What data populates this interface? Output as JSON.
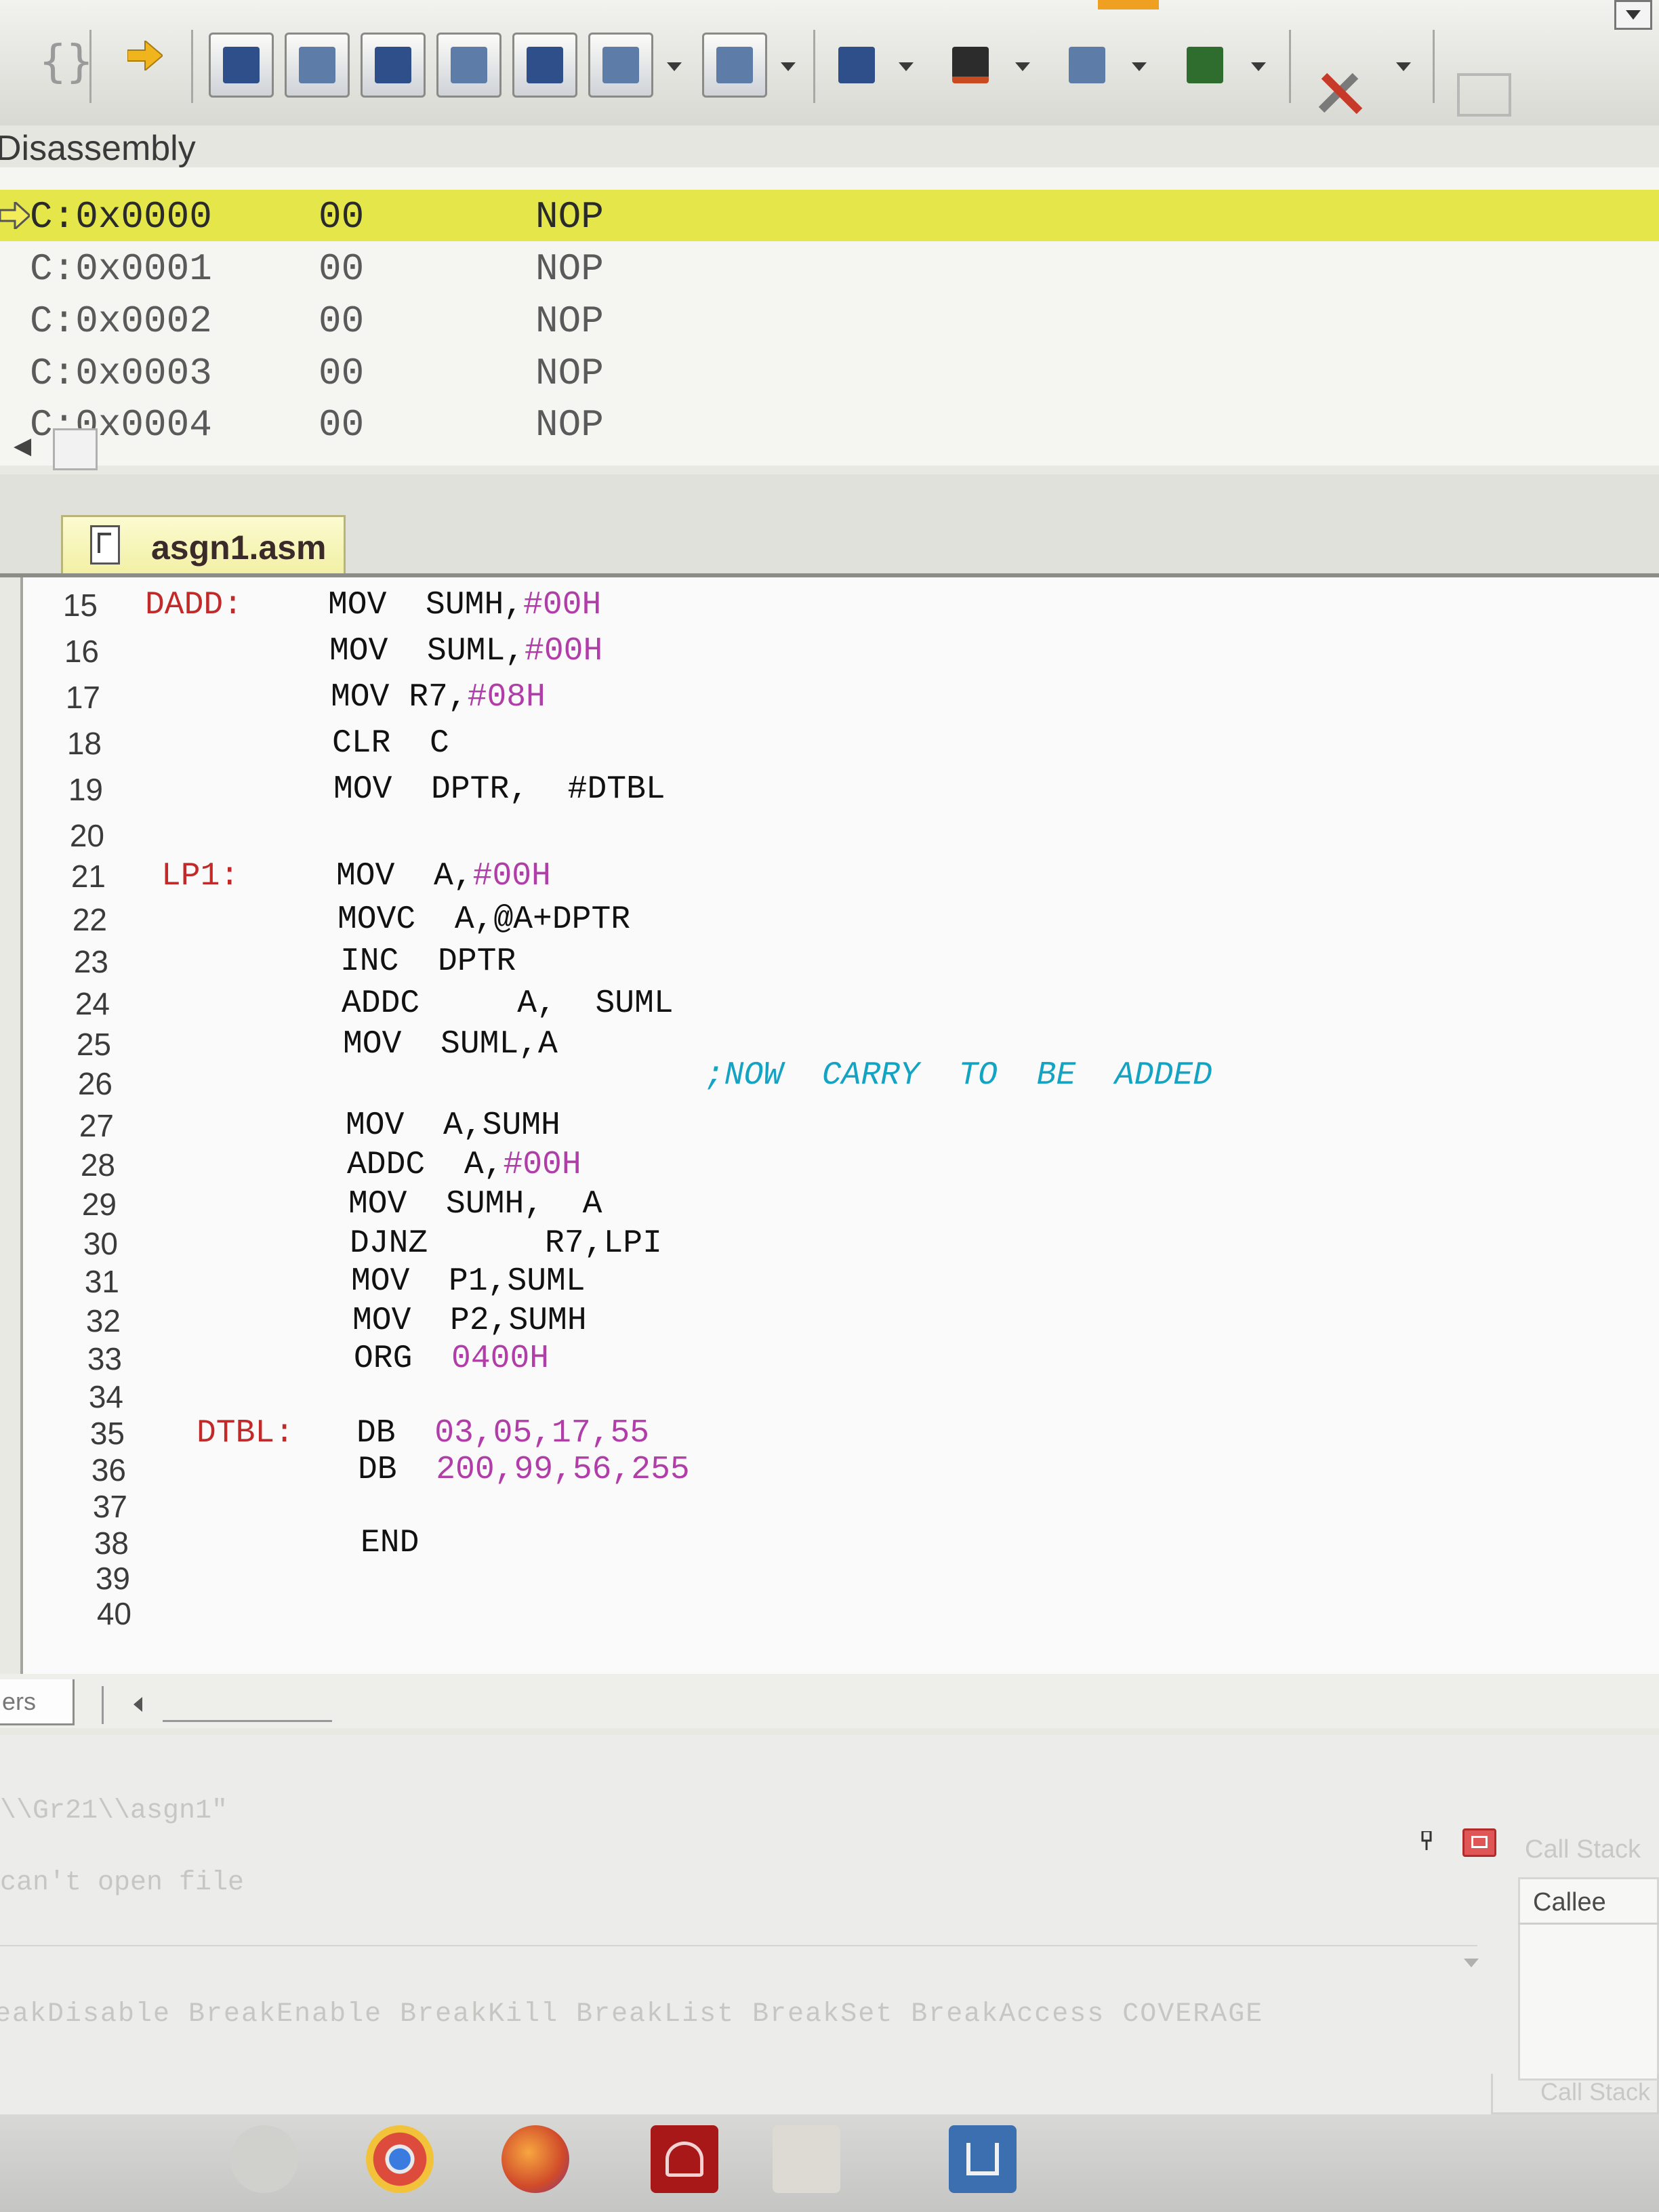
{
  "toolbar": {
    "left_glyph": "{}",
    "buttons": [
      "command-window-icon",
      "disassembly-window-icon",
      "symbols-window-icon",
      "registers-window-icon",
      "call-stack-window-icon",
      "watch-window-icon",
      "memory-window-icon",
      "serial-window-icon",
      "analysis-window-icon",
      "trace-window-icon",
      "system-viewer-icon",
      "toolbox-icon"
    ]
  },
  "disassembly": {
    "title": "Disassembly",
    "rows": [
      {
        "addr": "C:0x0000",
        "code": "00",
        "instr": "NOP",
        "current": true
      },
      {
        "addr": "C:0x0001",
        "code": "00",
        "instr": "NOP"
      },
      {
        "addr": "C:0x0002",
        "code": "00",
        "instr": "NOP"
      },
      {
        "addr": "C:0x0003",
        "code": "00",
        "instr": "NOP"
      },
      {
        "addr": "C:0x0004",
        "code": "00",
        "instr": "NOP"
      }
    ],
    "highlight_color": "#e4e64a"
  },
  "editor": {
    "tab_name": "asgn1.asm",
    "lines": {
      "l15": {
        "num": "15",
        "label": "DADD:",
        "op": "MOV  SUMH,",
        "imm": "#00H"
      },
      "l16": {
        "num": "16",
        "op": "MOV  SUML,",
        "imm": "#00H"
      },
      "l17": {
        "num": "17",
        "op": "MOV R7,",
        "imm": "#08H"
      },
      "l18": {
        "num": "18",
        "op": "CLR  C"
      },
      "l19": {
        "num": "19",
        "op": "MOV  DPTR,  #DTBL"
      },
      "l20": {
        "num": "20"
      },
      "l21": {
        "num": "21",
        "label": "LP1:",
        "op": "MOV  A,",
        "imm": "#00H"
      },
      "l22": {
        "num": "22",
        "op": "MOVC  A,@A+DPTR"
      },
      "l23": {
        "num": "23",
        "op": "INC  DPTR"
      },
      "l24": {
        "num": "24",
        "op": "ADDC     A,  SUML"
      },
      "l25": {
        "num": "25",
        "op": "MOV  SUML,A"
      },
      "l26": {
        "num": "26",
        "comment": ";NOW  CARRY  TO  BE  ADDED"
      },
      "l27": {
        "num": "27",
        "op": "MOV  A,SUMH"
      },
      "l28": {
        "num": "28",
        "op": "ADDC  A,",
        "imm": "#00H"
      },
      "l29": {
        "num": "29",
        "op": "MOV  SUMH,  A"
      },
      "l30": {
        "num": "30",
        "op": "DJNZ      R7,LPI"
      },
      "l31": {
        "num": "31",
        "op": "MOV  P1,SUML"
      },
      "l32": {
        "num": "32",
        "op": "MOV  P2,SUMH"
      },
      "l33": {
        "num": "33",
        "op": "ORG  ",
        "imm": "0400H"
      },
      "l34": {
        "num": "34"
      },
      "l35": {
        "num": "35",
        "label": "DTBL:",
        "op": "DB  ",
        "imm": "03,05,17,55"
      },
      "l36": {
        "num": "36",
        "op": "DB  ",
        "imm": "200,99,56,255"
      },
      "l37": {
        "num": "37"
      },
      "l38": {
        "num": "38",
        "op": "END"
      },
      "l39": {
        "num": "39"
      },
      "l40": {
        "num": "40"
      }
    },
    "colors": {
      "label": "#c22a2a",
      "immediate": "#b03da8",
      "comment": "#14a3c2"
    }
  },
  "panel_tab": "ers",
  "output": {
    "line1": "\\\\Gr21\\\\asgn1\"",
    "line2": "can't open file",
    "commands": "eakDisable BreakEnable BreakKill BreakList BreakSet BreakAccess COVERAGE"
  },
  "call_stack": {
    "title": "Call Stack",
    "column": "Callee",
    "tab": "Call Stack"
  },
  "taskbar": {
    "apps": [
      "chrome-icon",
      "firefox-icon",
      "acrobat-icon",
      "folder-icon",
      "keil-icon"
    ]
  }
}
